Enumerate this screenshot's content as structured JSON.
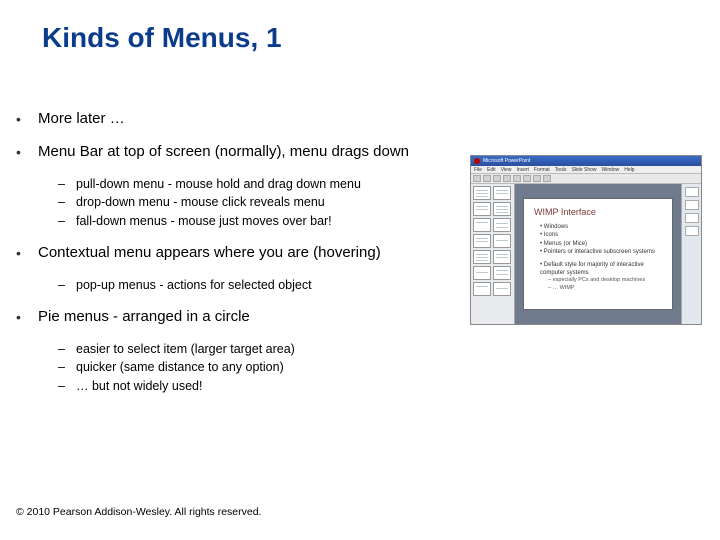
{
  "title": "Kinds of Menus, 1",
  "bullets": {
    "b0": "More later …",
    "b1": "Menu Bar at top of screen (normally), menu drags down",
    "b1s": {
      "s0": "pull-down menu - mouse hold and drag down menu",
      "s1": "drop-down menu - mouse click reveals menu",
      "s2": "fall-down menus - mouse just moves over bar!"
    },
    "b2": "Contextual menu appears where you are (hovering)",
    "b2s": {
      "s0": "pop-up menus - actions for selected object"
    },
    "b3": "Pie menus - arranged in a circle",
    "b3s": {
      "s0": "easier to select item (larger target area)",
      "s1": "quicker (same distance to any option)",
      "s2": "… but not widely used!"
    }
  },
  "footer": "© 2010 Pearson Addison-Wesley. All rights reserved.",
  "illus": {
    "app_title": "Microsoft PowerPoint",
    "menu": {
      "m0": "File",
      "m1": "Edit",
      "m2": "View",
      "m3": "Insert",
      "m4": "Format",
      "m5": "Tools",
      "m6": "Slide Show",
      "m7": "Window",
      "m8": "Help"
    },
    "slide_title": "WIMP Interface",
    "li0": "Windows",
    "li1": "Icons",
    "li2": "Menus (or Mice)",
    "li3": "Pointers or interactive subscreen systems",
    "li4": "Default style for majority of interactive computer systems",
    "li4a": "especially PCs and desktop machines",
    "li4b": "… WIMP"
  }
}
